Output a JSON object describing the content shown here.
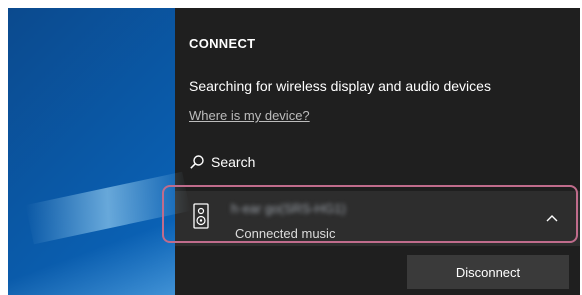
{
  "connect_panel": {
    "title": "CONNECT",
    "status_text": "Searching for wireless display and audio devices",
    "help_link": "Where is my device?",
    "search": {
      "label": "Search",
      "icon": "search-icon"
    },
    "device": {
      "name": "h·ear go(SRS-HG1)",
      "status": "Connected music",
      "icon": "speaker-icon",
      "expand_icon": "chevron-up-icon",
      "disconnect_label": "Disconnect"
    }
  },
  "colors": {
    "panel_bg": "#1f1f1f",
    "device_bg": "#2d2d2d",
    "highlight": "#c06c8c",
    "desktop_blue": "#0a62b6"
  }
}
